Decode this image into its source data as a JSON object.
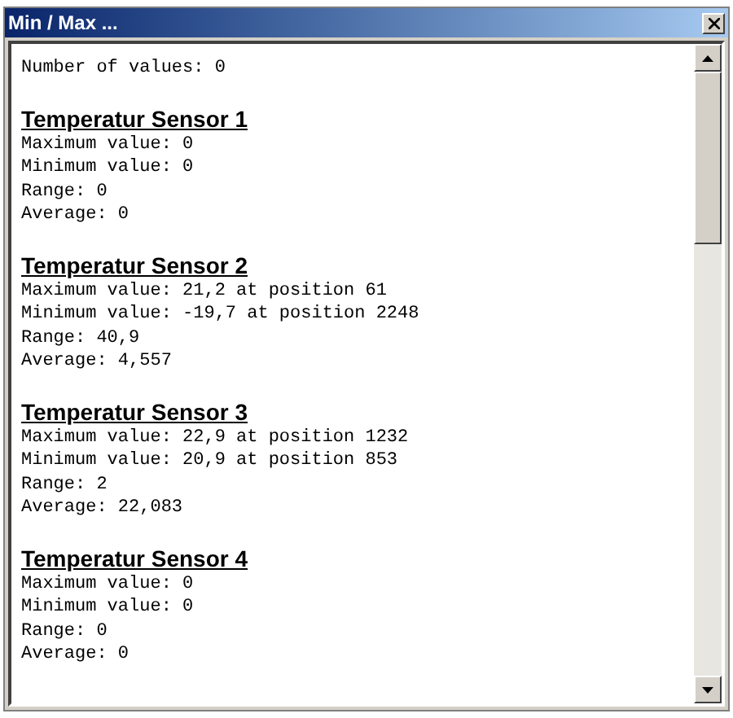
{
  "window": {
    "title": "Min / Max ..."
  },
  "summary": "Number of values: 0",
  "sensors": [
    {
      "title": "Temperatur Sensor 1",
      "lines": [
        "Maximum value: 0",
        "Minimum value: 0",
        "Range: 0",
        "Average: 0"
      ]
    },
    {
      "title": "Temperatur Sensor 2",
      "lines": [
        "Maximum value: 21,2 at position 61",
        "Minimum value: -19,7 at position 2248",
        "Range: 40,9",
        "Average: 4,557"
      ]
    },
    {
      "title": "Temperatur Sensor 3",
      "lines": [
        "Maximum value: 22,9 at position 1232",
        "Minimum value: 20,9 at position 853",
        "Range: 2",
        "Average: 22,083"
      ]
    },
    {
      "title": "Temperatur Sensor 4",
      "lines": [
        "Maximum value: 0",
        "Minimum value: 0",
        "Range: 0",
        "Average: 0"
      ]
    }
  ]
}
